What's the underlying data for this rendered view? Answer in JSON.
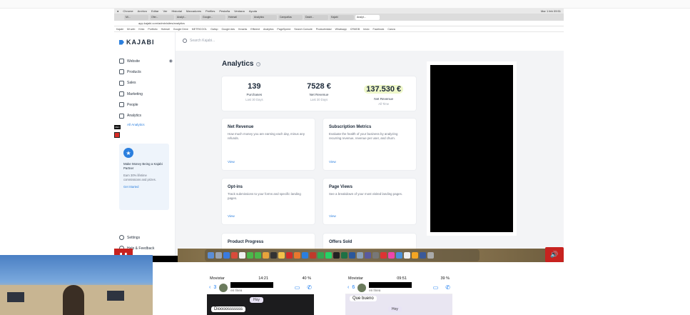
{
  "browser": {
    "menubar": [
      "Chrome",
      "Archivo",
      "Editar",
      "Ver",
      "Historial",
      "Marcadores",
      "Perfiles",
      "Pestaña",
      "Ventana",
      "Ayuda"
    ],
    "menubar_right": "Mar 1 feb 09:51",
    "tabs": [
      "Mi...",
      "Ofer...",
      "Analyt...",
      "Google...",
      "Hotmail",
      "Analytics",
      "Campañas",
      "Dasht...",
      "Kajabi",
      "Analyt..."
    ],
    "address": "app.kajabi.com/admin/sites/analytics",
    "bookmarks": [
      "Kajabi",
      "Mi web",
      "Kinlo",
      "Portfolio",
      "Hotmail",
      "Google Drive",
      "METRICOOL",
      "Gallup",
      "Google Ads",
      "Kmarks",
      "Efficient",
      "Analytics",
      "PageSpeed",
      "Search Console",
      "Productividad",
      "Whatsapp",
      "CRMGB",
      "Inicio",
      "Facebook",
      "Canva"
    ]
  },
  "sidebar": {
    "logo": "KAJABI",
    "items": [
      {
        "label": "Website",
        "icon": "monitor-icon"
      },
      {
        "label": "Products",
        "icon": "box-icon"
      },
      {
        "label": "Sales",
        "icon": "tag-icon"
      },
      {
        "label": "Marketing",
        "icon": "megaphone-icon"
      },
      {
        "label": "People",
        "icon": "people-icon"
      },
      {
        "label": "Analytics",
        "icon": "chart-icon"
      }
    ],
    "subitem": "All Analytics",
    "partner": {
      "title": "Make Money Being a Kajabi Partner",
      "desc": "Earn 30% lifetime commissions and prizes.",
      "link": "Get Started"
    },
    "bottom": [
      {
        "label": "Settings",
        "icon": "gear-icon"
      },
      {
        "label": "Help & Feedback",
        "icon": "help-icon"
      }
    ]
  },
  "search": {
    "placeholder": "Search Kajabi..."
  },
  "page": {
    "title": "Analytics",
    "stats": [
      {
        "value": "139",
        "name": "Purchases",
        "period": "Last 30 Days"
      },
      {
        "value": "7528 €",
        "name": "Net Revenue",
        "period": "Last 30 Days"
      },
      {
        "value": "137.530 €",
        "name": "Net Revenue",
        "period": "All Time"
      }
    ],
    "cards": [
      {
        "title": "Net Revenue",
        "body": "How much money you are earning each day, minus any refunds.",
        "link": "View"
      },
      {
        "title": "Subscription Metrics",
        "body": "Evaluate the health of your business by analyzing recurring revenue, revenue per user, and churn.",
        "link": "View"
      },
      {
        "title": "Opt-ins",
        "body": "Track submissions to your forms and specific landing pages.",
        "link": "View"
      },
      {
        "title": "Page Views",
        "body": "See a breakdown of your most visited landing pages.",
        "link": "View"
      },
      {
        "title": "Product Progress",
        "body": "",
        "link": ""
      },
      {
        "title": "Offers Sold",
        "body": "",
        "link": ""
      }
    ]
  },
  "phones": [
    {
      "carrier": "Movistar",
      "time": "14:21",
      "battery": "40 %",
      "back": "3",
      "status": "en línea",
      "day": "Hoy",
      "message": "Dioooosssssss"
    },
    {
      "carrier": "Movistar",
      "time": "09:51",
      "battery": "39 %",
      "back": "6",
      "status": "en línea",
      "day": "Hoy",
      "message": "Que bueno"
    }
  ]
}
